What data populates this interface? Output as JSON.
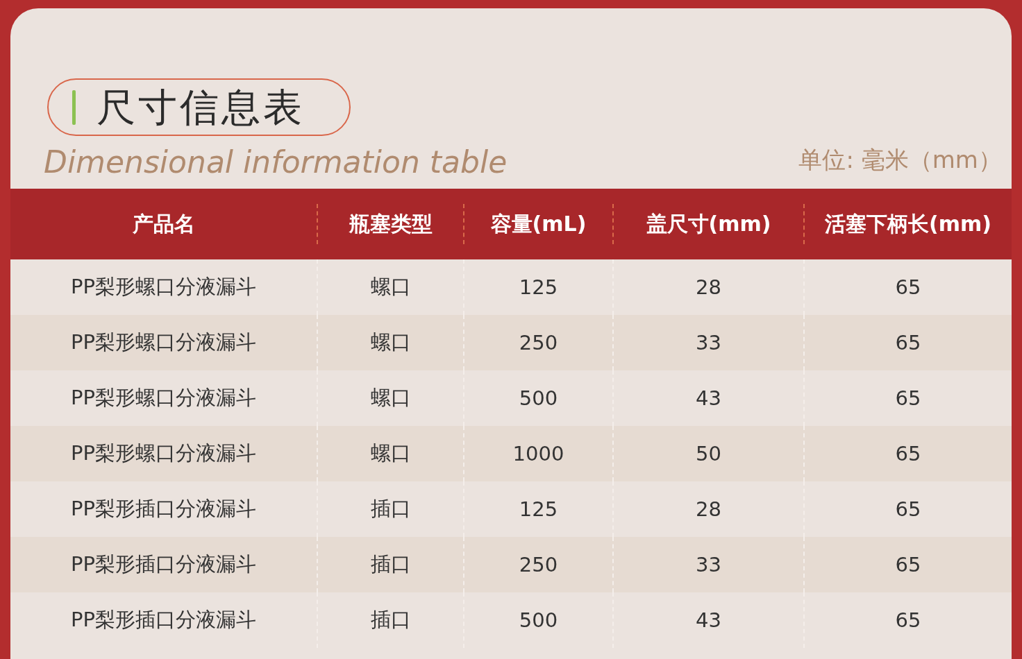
{
  "title": "尺寸信息表",
  "subtitle": "Dimensional information table",
  "unit": "单位: 毫米（mm）",
  "table": {
    "columns": [
      "产品名",
      "瓶塞类型",
      "容量(mL)",
      "盖尺寸(mm)",
      "活塞下柄长(mm)"
    ],
    "rows": [
      [
        "PP梨形螺口分液漏斗",
        "螺口",
        "125",
        "28",
        "65"
      ],
      [
        "PP梨形螺口分液漏斗",
        "螺口",
        "250",
        "33",
        "65"
      ],
      [
        "PP梨形螺口分液漏斗",
        "螺口",
        "500",
        "43",
        "65"
      ],
      [
        "PP梨形螺口分液漏斗",
        "螺口",
        "1000",
        "50",
        "65"
      ],
      [
        "PP梨形插口分液漏斗",
        "插口",
        "125",
        "28",
        "65"
      ],
      [
        "PP梨形插口分液漏斗",
        "插口",
        "250",
        "33",
        "65"
      ],
      [
        "PP梨形插口分液漏斗",
        "插口",
        "500",
        "43",
        "65"
      ]
    ]
  }
}
